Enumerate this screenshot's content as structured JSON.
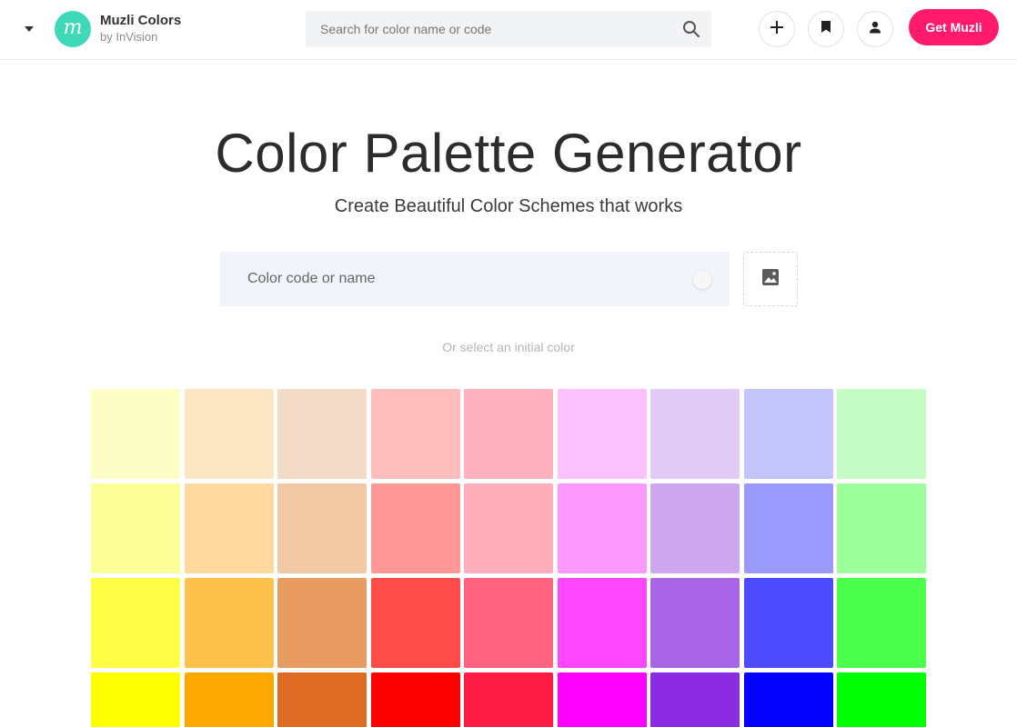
{
  "header": {
    "brand_title": "Muzli Colors",
    "brand_sub": "by InVision",
    "logo_letter": "m",
    "search_placeholder": "Search for color name or code",
    "get_button": "Get Muzli",
    "icons": [
      "chevron-down-icon",
      "search-icon",
      "plus-icon",
      "bookmark-icon",
      "user-icon"
    ],
    "accent": "#ff1a6c",
    "logo_color": "#3fd8b8"
  },
  "hero": {
    "title": "Color Palette Generator",
    "subtitle": "Create Beautiful Color Schemes that works",
    "input_placeholder": "Color code or name",
    "image_button_icon": "image-icon",
    "or_select": "Or select an initial color"
  },
  "palette": [
    [
      "#fdfec6",
      "#fde6c3",
      "#f3dcc7",
      "#ffbdbe",
      "#ffb1bf",
      "#fcc2ff",
      "#e2cbf6",
      "#c5c5fd",
      "#c6fdc6"
    ],
    [
      "#fcfe98",
      "#fed89d",
      "#f2c9a5",
      "#ff9897",
      "#ffafbc",
      "#fd99fe",
      "#cea7f1",
      "#9a9afe",
      "#9cff9b"
    ],
    [
      "#fdfe45",
      "#fec14b",
      "#e99c61",
      "#ff4c4b",
      "#fe6380",
      "#fd47fe",
      "#a865e6",
      "#4c4cfe",
      "#4bff4a"
    ],
    [
      "#fdfe00",
      "#fda800",
      "#dd6c22",
      "#fd0100",
      "#fd1a45",
      "#fd00fe",
      "#8b2be2",
      "#0300fe",
      "#00ff00"
    ]
  ]
}
